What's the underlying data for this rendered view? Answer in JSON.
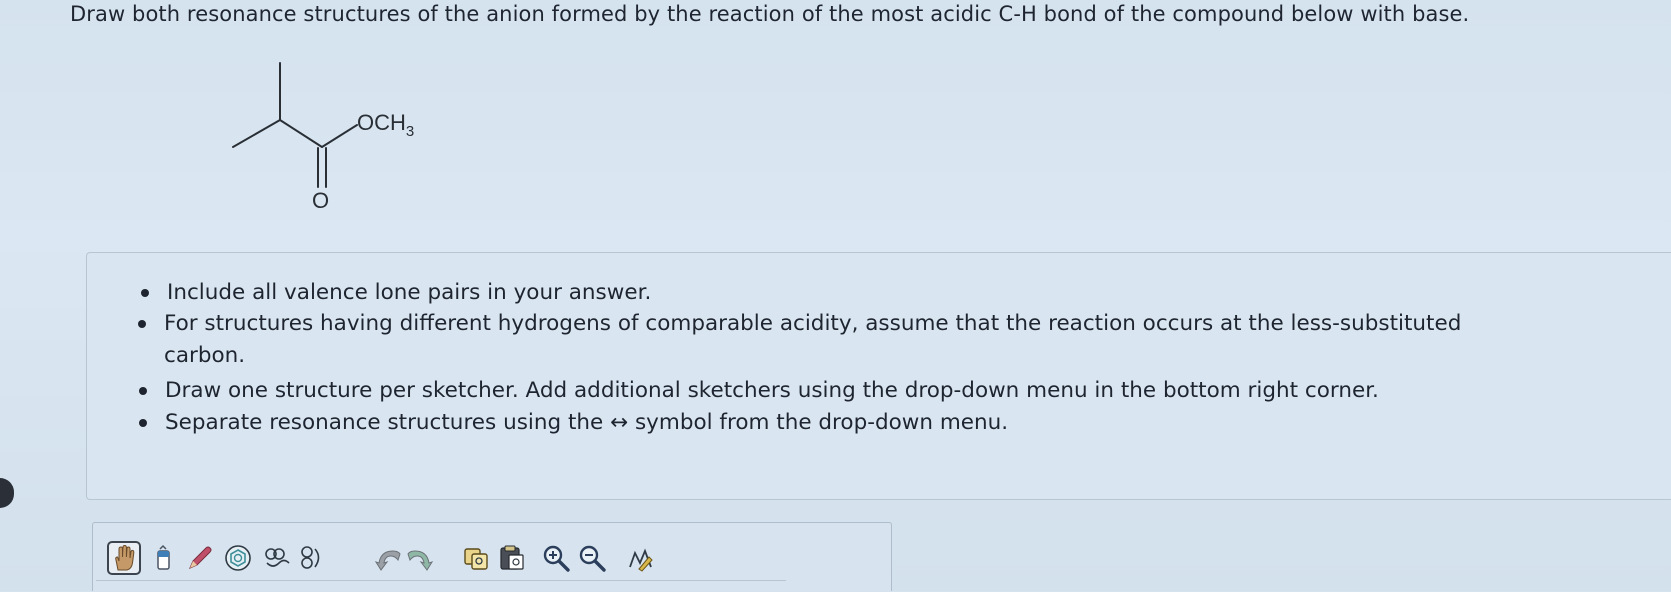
{
  "question": {
    "text": "Draw both resonance structures of the anion formed by the reaction of the most acidic C-H bond of the compound below with base."
  },
  "molecule": {
    "och3_label": "OCH",
    "och3_subscript": "3",
    "oxygen_label": "O"
  },
  "instructions": {
    "items": [
      "Include all valence lone pairs in your answer.",
      "For structures having different hydrogens of comparable acidity, assume that the reaction occurs at the less-substituted",
      "carbon.",
      "Draw one structure per sketcher. Add additional sketchers using the drop-down menu in the bottom right corner.",
      "Separate resonance structures using the ↔ symbol from the drop-down menu."
    ]
  },
  "toolbar": {
    "tools": [
      {
        "name": "hand-tool",
        "icon": "hand-icon"
      },
      {
        "name": "eraser-tool",
        "icon": "eraser-icon"
      },
      {
        "name": "pencil-tool",
        "icon": "pencil-icon"
      },
      {
        "name": "ring-tool",
        "icon": "benzene-ring-icon"
      },
      {
        "name": "chain-tool",
        "icon": "chain-icon"
      },
      {
        "name": "undo-tool",
        "icon": "undo-icon"
      },
      {
        "name": "redo-tool",
        "icon": "redo-icon"
      },
      {
        "name": "copy-tool",
        "icon": "copy-icon"
      },
      {
        "name": "paste-tool",
        "icon": "paste-icon"
      },
      {
        "name": "zoom-in-tool",
        "icon": "zoom-in-icon"
      },
      {
        "name": "zoom-out-tool",
        "icon": "zoom-out-icon"
      },
      {
        "name": "clean-tool",
        "icon": "clean-structure-icon"
      }
    ]
  },
  "colors": {
    "background": "#d8e5f0",
    "text": "#1e2530",
    "toolbar_border": "#aebccb",
    "pencil_pink": "#c0506a",
    "ring_teal": "#3e8f9a",
    "arrow_gray": "#8c9097"
  }
}
